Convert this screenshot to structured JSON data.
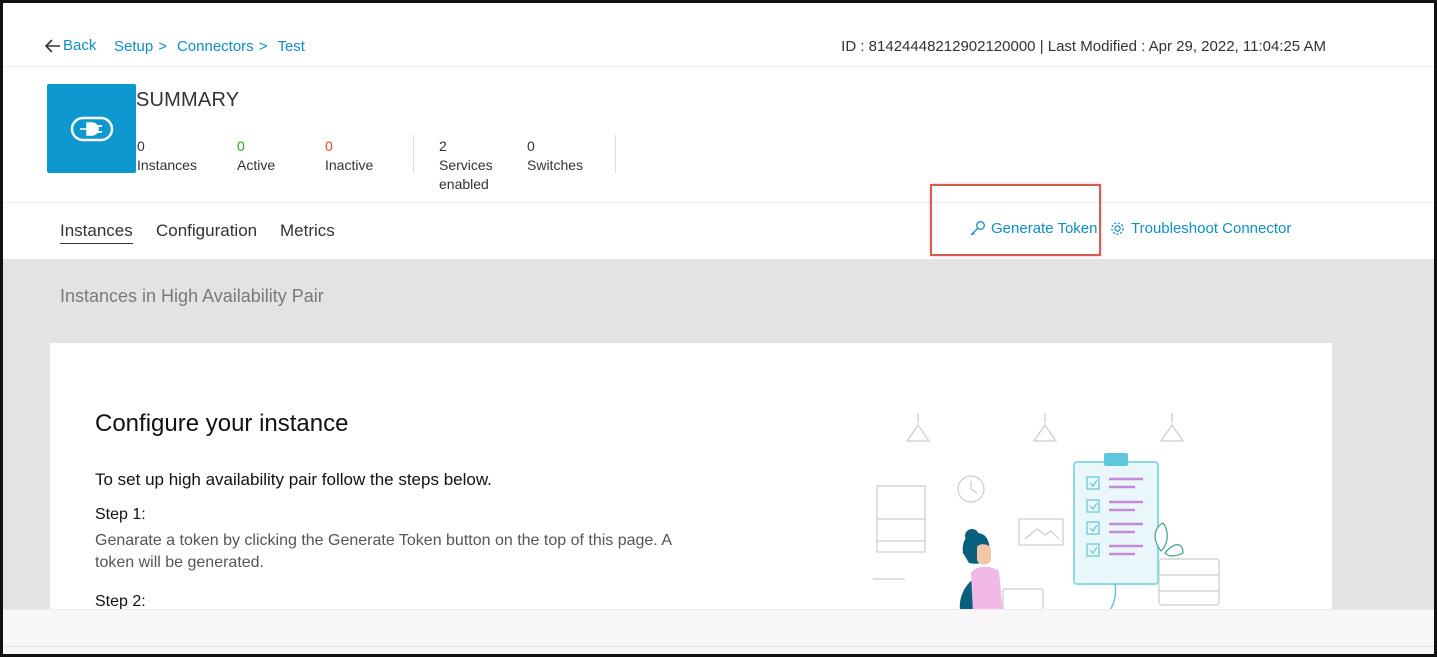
{
  "nav": {
    "back_label": "Back",
    "breadcrumbs": [
      "Setup",
      "Connectors",
      "Test"
    ],
    "separator": ">",
    "meta": "ID : 81424448212902120000 | Last Modified : Apr 29, 2022, 11:04:25 AM"
  },
  "summary": {
    "title": "SUMMARY",
    "icon": "plug-connector-icon",
    "stats": [
      {
        "value": "0",
        "label": "Instances"
      },
      {
        "value": "0",
        "label": "Active"
      },
      {
        "value": "0",
        "label": "Inactive"
      },
      {
        "value": "2",
        "label": "Services enabled"
      },
      {
        "value": "0",
        "label": "Switches"
      }
    ]
  },
  "tabs": [
    "Instances",
    "Configuration",
    "Metrics"
  ],
  "active_tab": "Instances",
  "actions": {
    "generate_token": "Generate Token",
    "troubleshoot": "Troubleshoot Connector"
  },
  "section": {
    "title": "Instances in High Availability Pair"
  },
  "card": {
    "title": "Configure your instance",
    "intro": "To set up high availability pair follow the steps below.",
    "step1_label": "Step 1:",
    "step1_text": "Genarate a token by clicking the Generate Token button on the top of this page. A token will be generated.",
    "step2_label": "Step 2:"
  },
  "colors": {
    "accent": "#0d8fc6",
    "tile": "#0d98d0",
    "active": "#2e9b1f",
    "inactive": "#d04a2a",
    "highlight": "#d85b4f"
  }
}
